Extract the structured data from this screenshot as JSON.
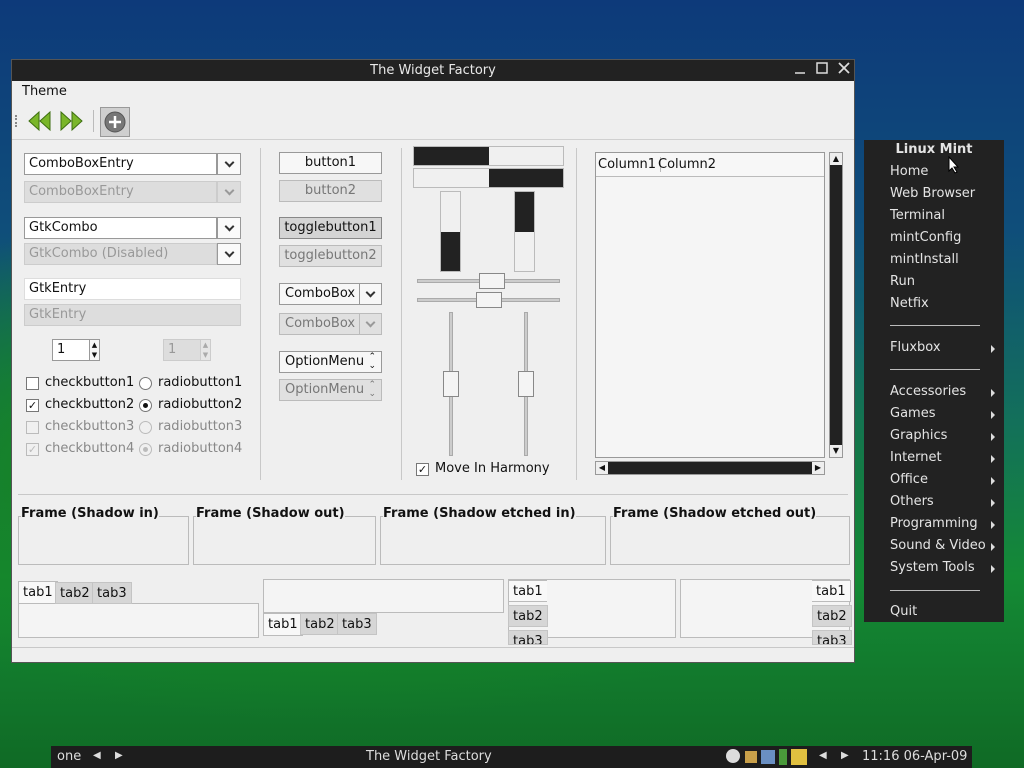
{
  "window": {
    "title": "The Widget Factory",
    "menu": "Theme"
  },
  "toolbar": {
    "back": "back-arrow",
    "forward": "forward-arrow",
    "add": "add"
  },
  "combos": {
    "comboboxentry": "ComboBoxEntry",
    "comboboxentry_dis": "ComboBoxEntry",
    "gtkcombo": "GtkCombo",
    "gtkcombo_dis": "GtkCombo (Disabled)",
    "entry": "GtkEntry",
    "entry_dis": "GtkEntry",
    "spin1": "1",
    "spin2": "1"
  },
  "checks": {
    "c1": "checkbutton1",
    "c2": "checkbutton2",
    "c3": "checkbutton3",
    "c4": "checkbutton4",
    "r1": "radiobutton1",
    "r2": "radiobutton2",
    "r3": "radiobutton3",
    "r4": "radiobutton4"
  },
  "buttons": {
    "b1": "button1",
    "b2": "button2",
    "t1": "togglebutton1",
    "t2": "togglebutton2",
    "combo": "ComboBox",
    "combo_dis": "ComboBox",
    "option": "OptionMenu",
    "option_dis": "OptionMenu"
  },
  "progress": {
    "h1": 0.5,
    "h2": 0.5,
    "v1": 0.5,
    "v2": 0.5
  },
  "sliders": {
    "harmony": "Move In Harmony"
  },
  "tree": {
    "col1": "Column1",
    "col2": "Column2"
  },
  "frames": {
    "f1": "Frame (Shadow in)",
    "f2": "Frame (Shadow out)",
    "f3": "Frame (Shadow etched in)",
    "f4": "Frame (Shadow etched out)"
  },
  "tabs": {
    "t1": "tab1",
    "t2": "tab2",
    "t3": "tab3"
  },
  "rootmenu": {
    "title": "Linux Mint",
    "items": [
      "Home",
      "Web Browser",
      "Terminal",
      "mintConfig",
      "mintInstall",
      "Run",
      "Netfix"
    ],
    "fluxbox": "Fluxbox",
    "sub": [
      "Accessories",
      "Games",
      "Graphics",
      "Internet",
      "Office",
      "Others",
      "Programming",
      "Sound & Video",
      "System Tools"
    ],
    "quit": "Quit"
  },
  "panel": {
    "workspace": "one",
    "title": "The Widget Factory",
    "clock": "11:16 06-Apr-09"
  }
}
